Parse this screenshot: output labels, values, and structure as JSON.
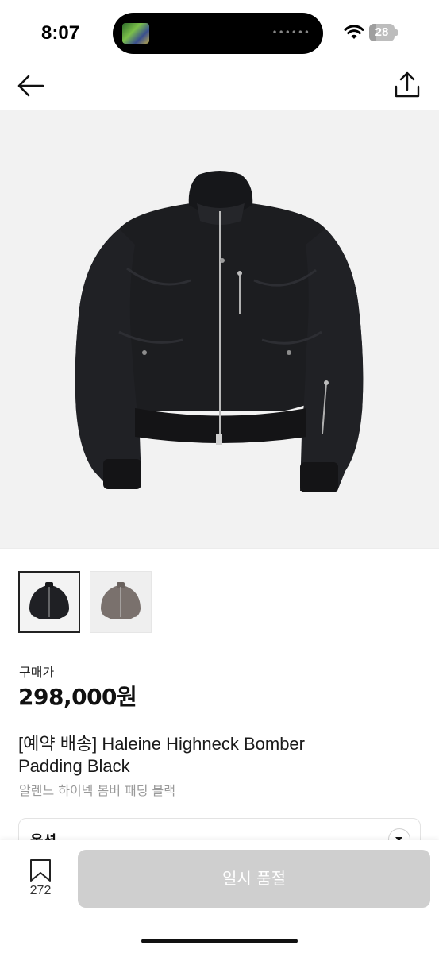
{
  "status_bar": {
    "time": "8:07",
    "battery_level": "28",
    "battery_fraction": 0.28
  },
  "nav": {
    "back_icon": "arrow-left-icon",
    "share_icon": "share-upload-icon"
  },
  "gallery": {
    "thumbnail_count": 2,
    "selected_index": 0,
    "thumbnails": [
      {
        "color": "black"
      },
      {
        "color": "brown-gray"
      }
    ]
  },
  "product": {
    "price_label": "구매가",
    "price": "298,000원",
    "name_line1": "[예약 배송] Haleine Highneck Bomber",
    "name_line2": "Padding Black",
    "name_ko": "알렌느 하이넥 봄버 패딩 블랙"
  },
  "option": {
    "label": "옵션"
  },
  "bottom_bar": {
    "bookmark_count": "272",
    "cta_label": "일시 품절"
  },
  "colors": {
    "hero_bg": "#f2f2f2",
    "cta_disabled_bg": "#cfcfcf",
    "text_primary": "#111111",
    "text_muted": "#9a9a9a"
  }
}
